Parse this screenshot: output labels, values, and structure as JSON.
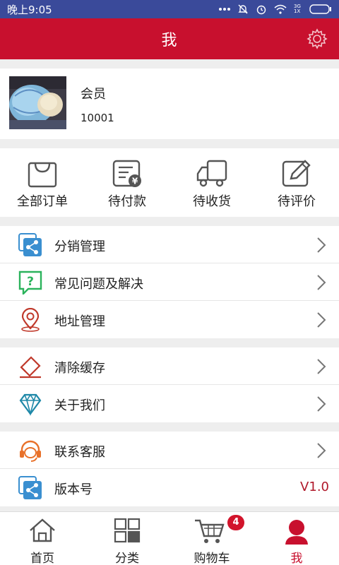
{
  "status_bar": {
    "time": "晚上9:05",
    "network": "3G 1X"
  },
  "app_bar": {
    "title": "我"
  },
  "profile": {
    "name": "会员",
    "id": "10001"
  },
  "orders": [
    {
      "label": "全部订单",
      "icon": "shopping-bag-icon"
    },
    {
      "label": "待付款",
      "icon": "bill-yen-icon"
    },
    {
      "label": "待收货",
      "icon": "truck-icon"
    },
    {
      "label": "待评价",
      "icon": "edit-note-icon"
    }
  ],
  "menu_group_1": [
    {
      "label": "分销管理",
      "icon": "share-icon"
    },
    {
      "label": "常见问题及解决",
      "icon": "question-chat-icon"
    },
    {
      "label": "地址管理",
      "icon": "location-pin-icon"
    }
  ],
  "menu_group_2": [
    {
      "label": "清除缓存",
      "icon": "eraser-icon"
    },
    {
      "label": "关于我们",
      "icon": "diamond-icon"
    }
  ],
  "menu_group_3": [
    {
      "label": "联系客服",
      "icon": "headset-icon"
    },
    {
      "label": "版本号",
      "icon": "share-icon",
      "value": "V1.0"
    }
  ],
  "tab_bar": [
    {
      "label": "首页",
      "icon": "home-icon"
    },
    {
      "label": "分类",
      "icon": "grid-icon"
    },
    {
      "label": "购物车",
      "icon": "cart-icon",
      "badge": "4"
    },
    {
      "label": "我",
      "icon": "person-icon",
      "active": true
    }
  ],
  "colors": {
    "primary": "#c8102e",
    "status_bar": "#3a4a9a",
    "background": "#eeeeee",
    "icon_blue": "#3a8fd0",
    "icon_green": "#2bb35c"
  }
}
